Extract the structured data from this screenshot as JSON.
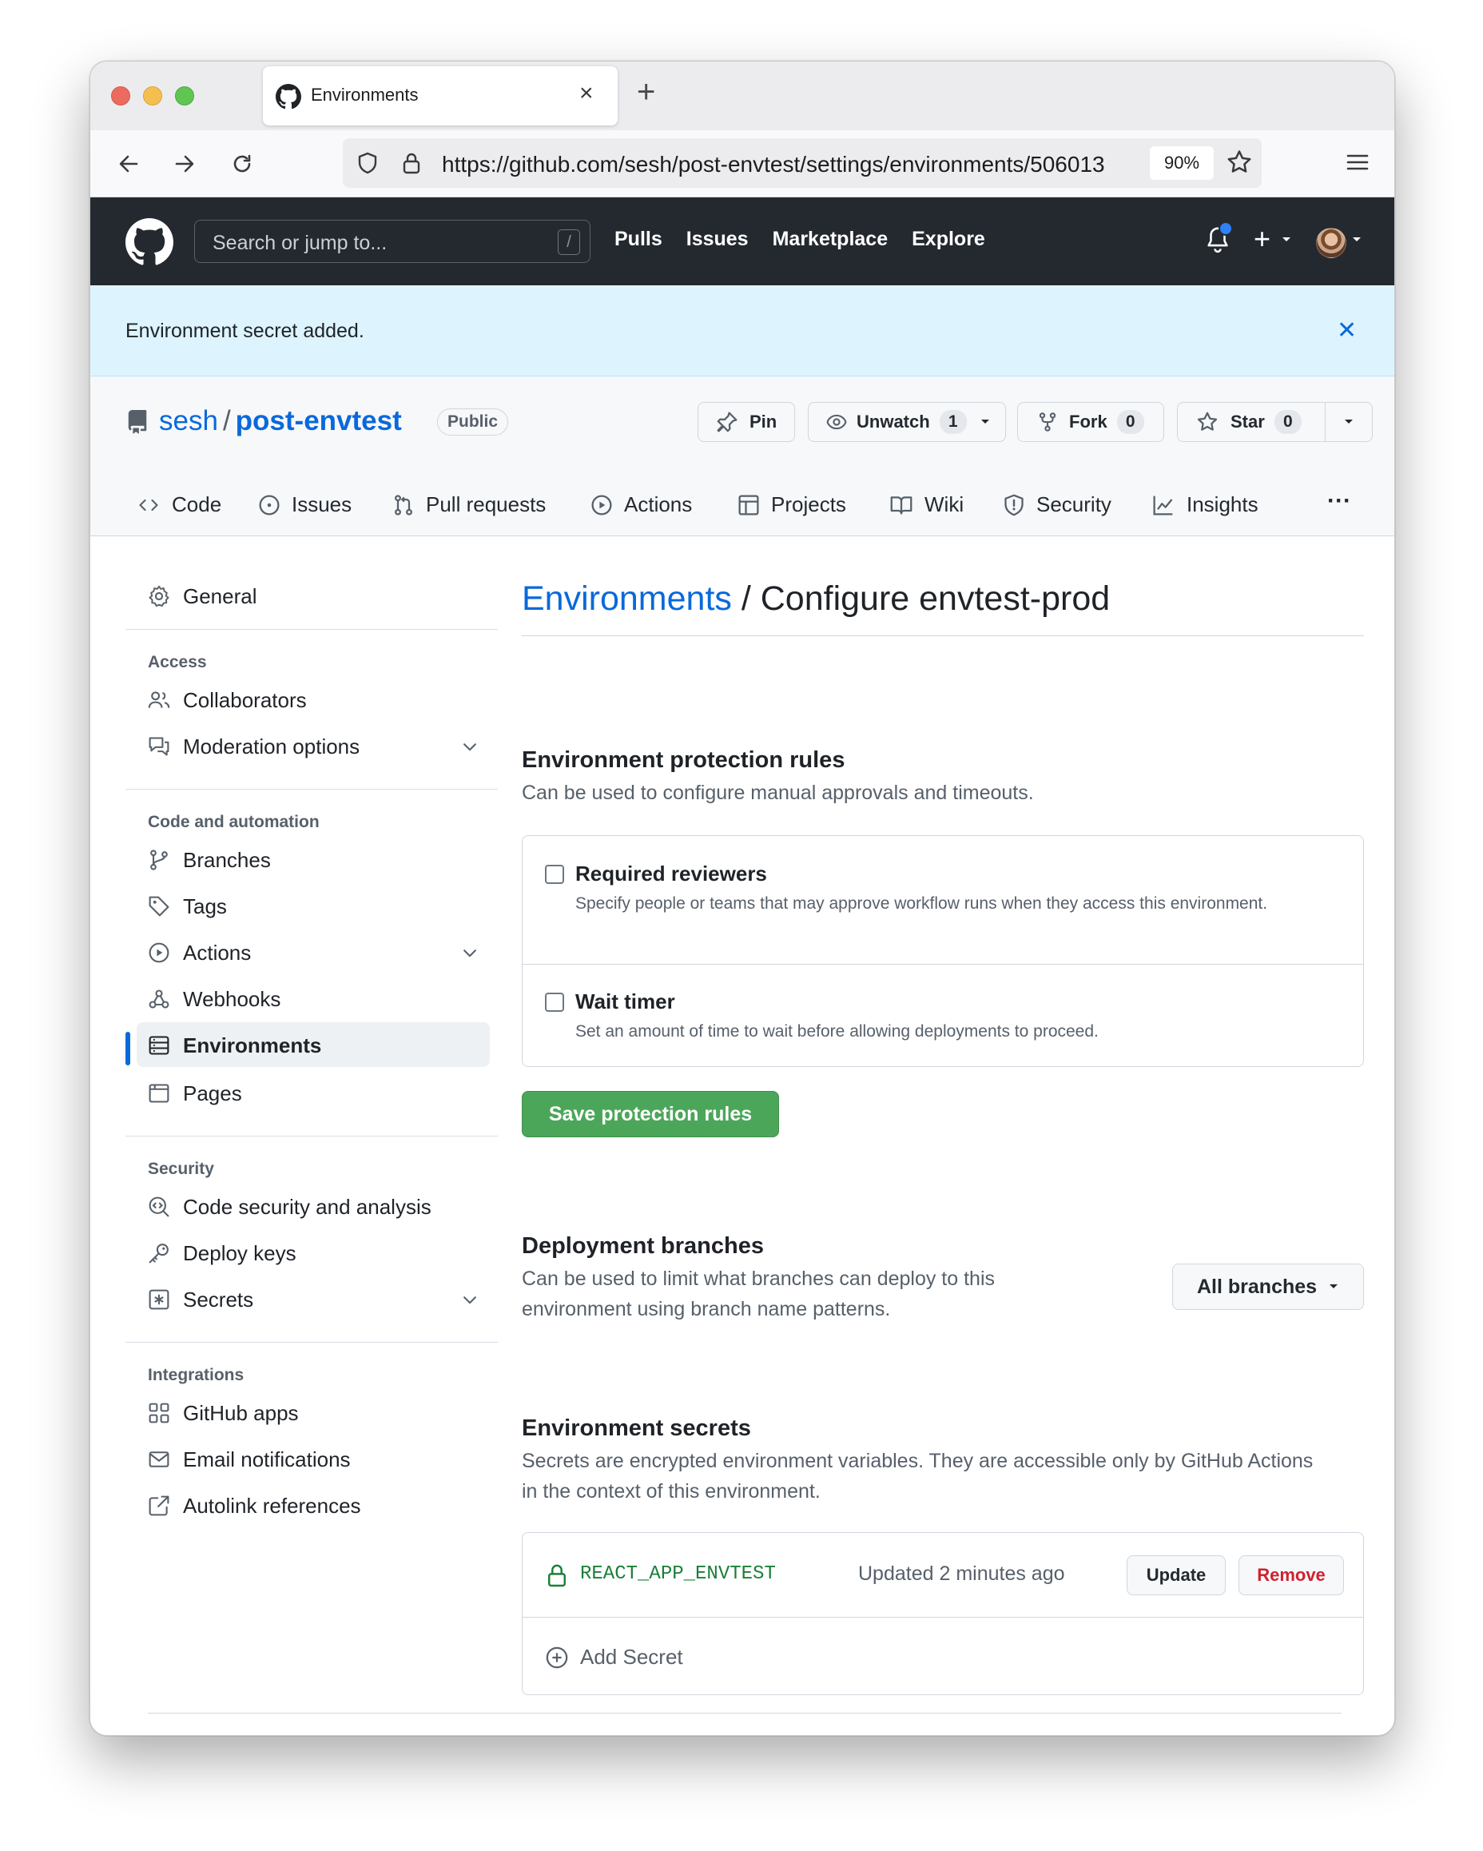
{
  "browser": {
    "tab_title": "Environments",
    "url": "https://github.com/sesh/post-envtest/settings/environments/506013",
    "zoom": "90%"
  },
  "github_header": {
    "search_placeholder": "Search or jump to...",
    "search_shortcut": "/",
    "nav": [
      "Pulls",
      "Issues",
      "Marketplace",
      "Explore"
    ]
  },
  "flash": {
    "message": "Environment secret added."
  },
  "repo": {
    "owner": "sesh",
    "separator": "/",
    "name": "post-envtest",
    "visibility": "Public",
    "pin_label": "Pin",
    "watch_label": "Unwatch",
    "watch_count": "1",
    "fork_label": "Fork",
    "fork_count": "0",
    "star_label": "Star",
    "star_count": "0",
    "tabs": [
      "Code",
      "Issues",
      "Pull requests",
      "Actions",
      "Projects",
      "Wiki",
      "Security",
      "Insights"
    ],
    "more": "···"
  },
  "sidebar": {
    "general": "General",
    "access_heading": "Access",
    "collaborators": "Collaborators",
    "moderation": "Moderation options",
    "code_heading": "Code and automation",
    "branches": "Branches",
    "tags": "Tags",
    "actions": "Actions",
    "webhooks": "Webhooks",
    "environments": "Environments",
    "pages": "Pages",
    "security_heading": "Security",
    "code_security": "Code security and analysis",
    "deploy_keys": "Deploy keys",
    "secrets": "Secrets",
    "integrations_heading": "Integrations",
    "github_apps": "GitHub apps",
    "email_notifications": "Email notifications",
    "autolink": "Autolink references"
  },
  "main": {
    "crumb_link": "Environments",
    "crumb_rest": " / Configure envtest-prod",
    "protection_title": "Environment protection rules",
    "protection_desc": "Can be used to configure manual approvals and timeouts.",
    "reviewers_title": "Required reviewers",
    "reviewers_desc": "Specify people or teams that may approve workflow runs when they access this environment.",
    "reviewers_checked": false,
    "timer_title": "Wait timer",
    "timer_desc": "Set an amount of time to wait before allowing deployments to proceed.",
    "timer_checked": false,
    "save_label": "Save protection rules",
    "branches_title": "Deployment branches",
    "branches_desc": "Can be used to limit what branches can deploy to this environment using branch name patterns.",
    "branches_select": "All branches",
    "secrets_title": "Environment secrets",
    "secrets_desc": "Secrets are encrypted environment variables. They are accessible only by GitHub Actions in the context of this environment.",
    "secret_name": "REACT_APP_ENVTEST",
    "secret_updated": "Updated 2 minutes ago",
    "update_label": "Update",
    "remove_label": "Remove",
    "add_secret_label": "Add Secret"
  },
  "colors": {
    "accent": "#0969da",
    "primary_button": "#4ca65a",
    "header_bg": "#24292f",
    "flash_bg": "#ddf4ff",
    "danger": "#cf222e",
    "secret_name": "#1a7f37"
  }
}
